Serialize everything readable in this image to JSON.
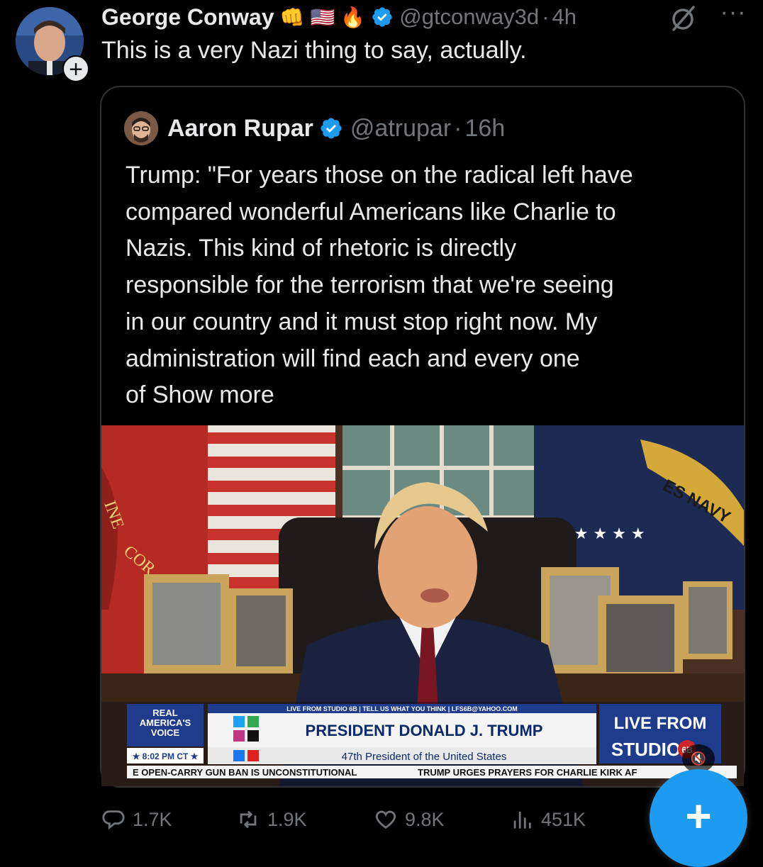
{
  "post": {
    "author_name": "George Conway",
    "author_emojis": [
      "👊",
      "🇺🇸",
      "🔥"
    ],
    "handle": "@gtconway3d",
    "separator": "·",
    "time": "4h",
    "more_glyph": "···",
    "follow_glyph": "+",
    "text": "This is a very Nazi thing to say, actually."
  },
  "quote": {
    "author_name": "Aaron Rupar",
    "handle": "@atrupar",
    "separator": "·",
    "time": "16h",
    "text_lines": [
      "Trump: \"For years those on the radical left have",
      "compared wonderful Americans like Charlie to",
      "Nazis. This kind of rhetoric is directly",
      "responsible for the terrorism that we're seeing",
      "in our country and it must stop right now. My",
      "administration will find each and every one",
      "of "
    ],
    "show_more": "Show more",
    "video": {
      "navy_seal_text": "ES NAVY",
      "marine_seal_text": "INE",
      "marine_seal_text2": "COR",
      "ticker_top": "LIVE FROM STUDIO 6B | TELL US WHAT YOU THINK | LFS6B@YAHOO.COM",
      "network": "REAL AMERICA'S VOICE",
      "network_line1": "REAL",
      "network_line2": "AMERICA'S",
      "network_line3": "VOICE",
      "clock": "★ 8:02 PM CT ★",
      "headline": "PRESIDENT DONALD J. TRUMP",
      "subheadline": "47th President of the United States",
      "show_logo_1": "LIVE FROM",
      "show_logo_2": "STUDIO",
      "show_logo_badge": "6B",
      "crawl_left": "E OPEN-CARRY GUN BAN IS UNCONSTITUTIONAL",
      "crawl_right": "TRUMP URGES PRAYERS FOR CHARLIE KIRK AF",
      "mute_glyph": "🔇"
    }
  },
  "actions": {
    "replies": "1.7K",
    "reposts": "1.9K",
    "likes": "9.8K",
    "views": "451K"
  },
  "fab": {
    "glyph": "+"
  },
  "colors": {
    "background": "#000000",
    "text": "#e7e9ea",
    "secondary": "#71767b",
    "accent": "#1d9bf0",
    "border": "#2f3336"
  }
}
